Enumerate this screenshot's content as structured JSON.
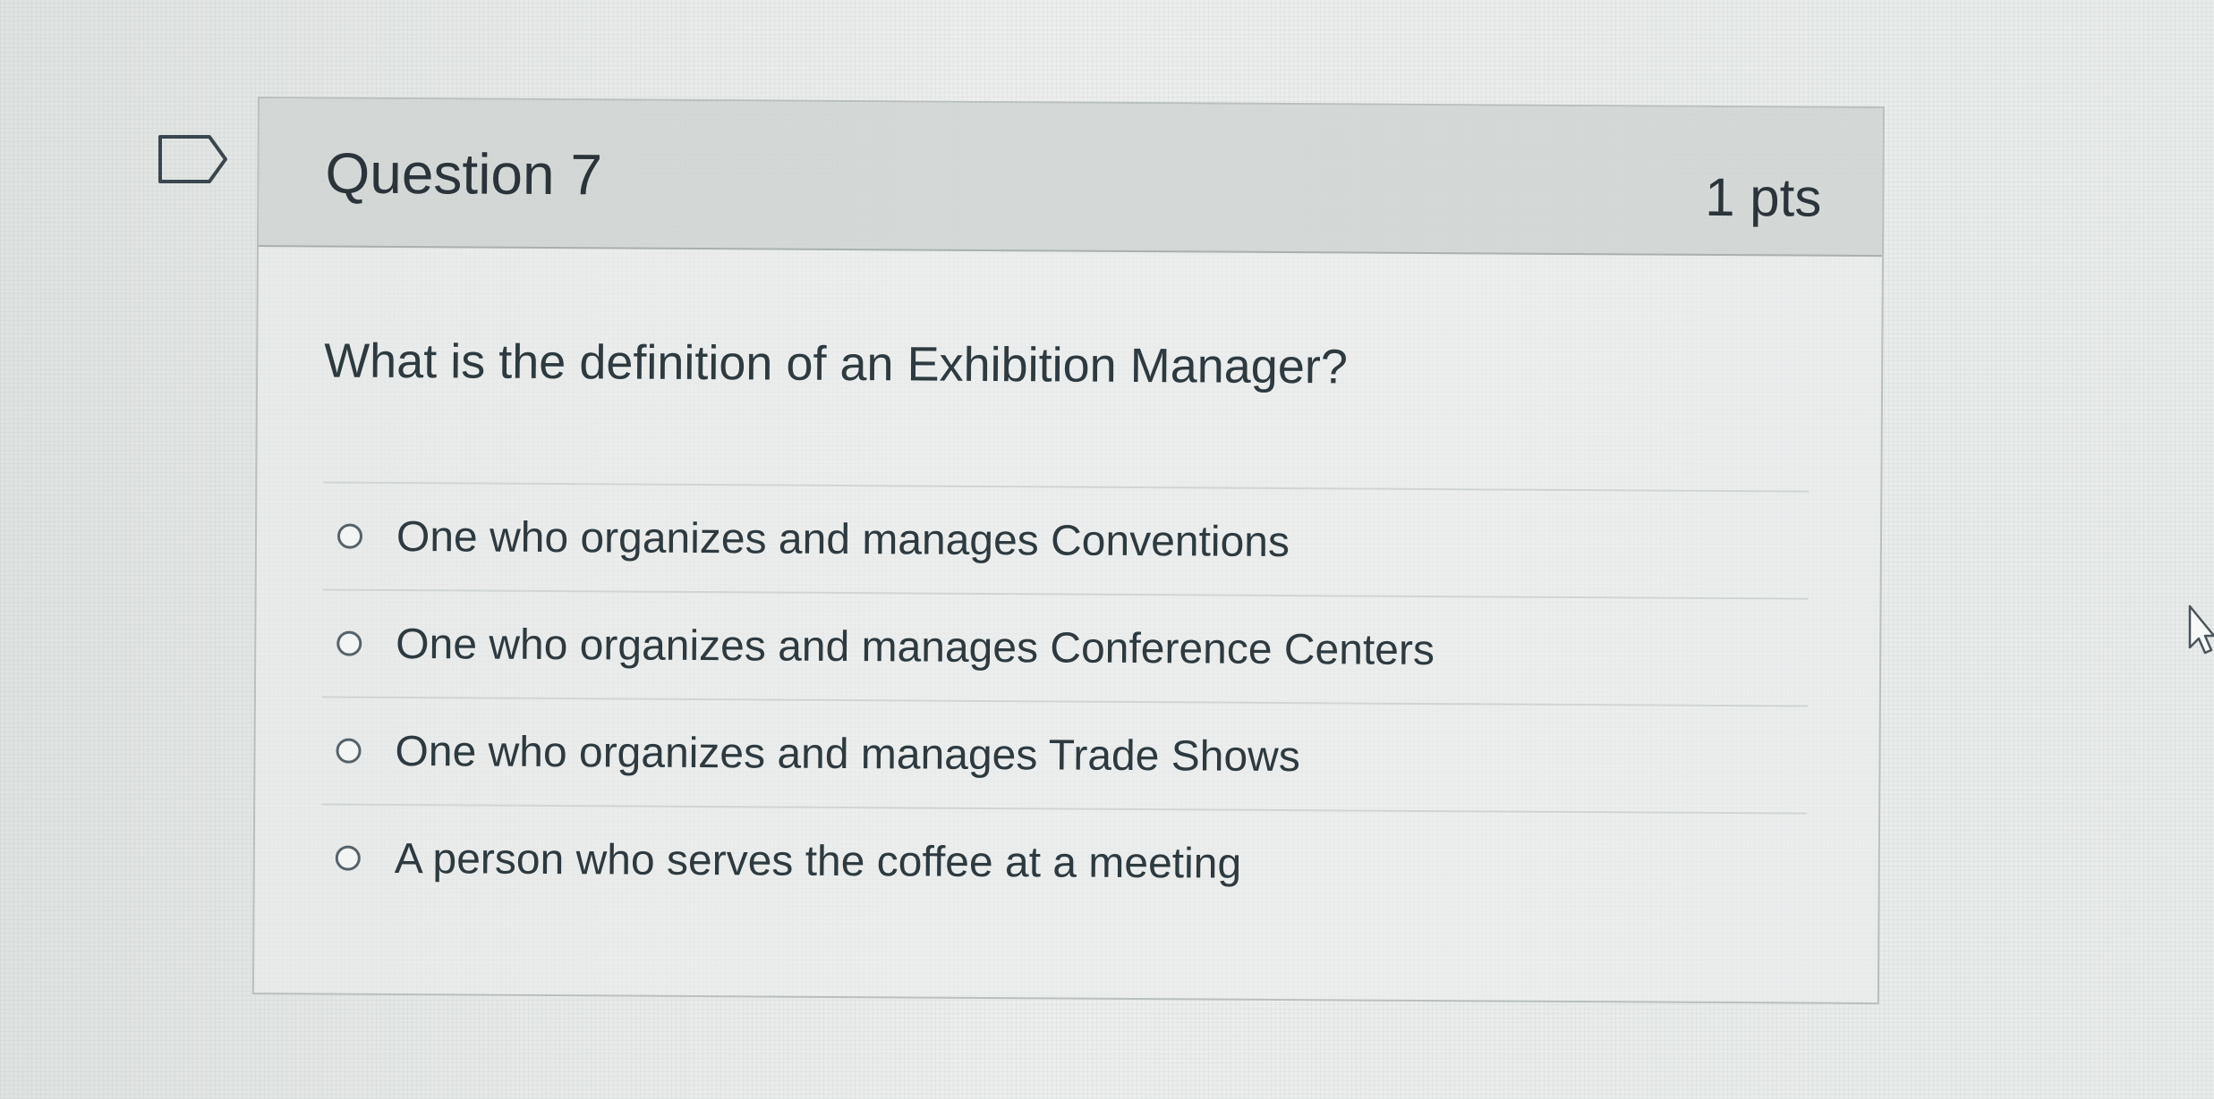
{
  "question": {
    "title": "Question 7",
    "points": "1 pts",
    "text": "What is the definition of an Exhibition Manager?",
    "answers": [
      {
        "label": "One who organizes and manages Conventions",
        "selected": false
      },
      {
        "label": "One who organizes and manages Conference Centers",
        "selected": false
      },
      {
        "label": "One who organizes and manages Trade Shows",
        "selected": false
      },
      {
        "label": "A person who serves the coffee at a meeting",
        "selected": false
      }
    ]
  },
  "icons": {
    "flag": "flag-question-icon",
    "radio": "radio-button-icon",
    "cursor": "mouse-pointer-icon"
  },
  "colors": {
    "text": "#2d3a40",
    "header_bg": "#cbd0ce",
    "border": "#b9c0be",
    "radio_border": "#566269"
  }
}
